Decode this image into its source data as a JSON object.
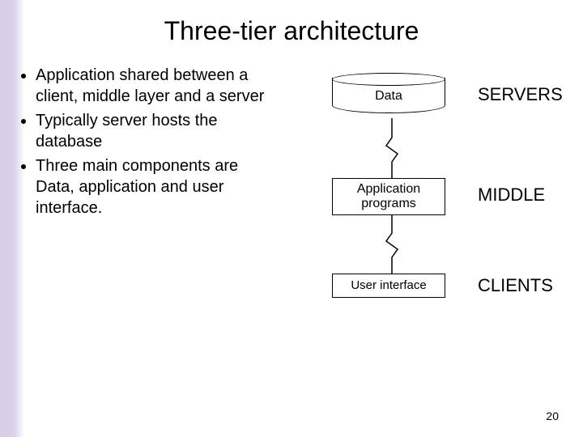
{
  "title": "Three-tier architecture",
  "bullets": [
    "Application shared between a client, middle layer and a server",
    "Typically server hosts the database",
    "Three main components are Data, application and user interface."
  ],
  "diagram": {
    "data_label": "Data",
    "app_label": "Application\nprograms",
    "ui_label": "User interface",
    "tier_servers": "SERVERS",
    "tier_middle": "MIDDLE",
    "tier_clients": "CLIENTS"
  },
  "page_number": "20"
}
